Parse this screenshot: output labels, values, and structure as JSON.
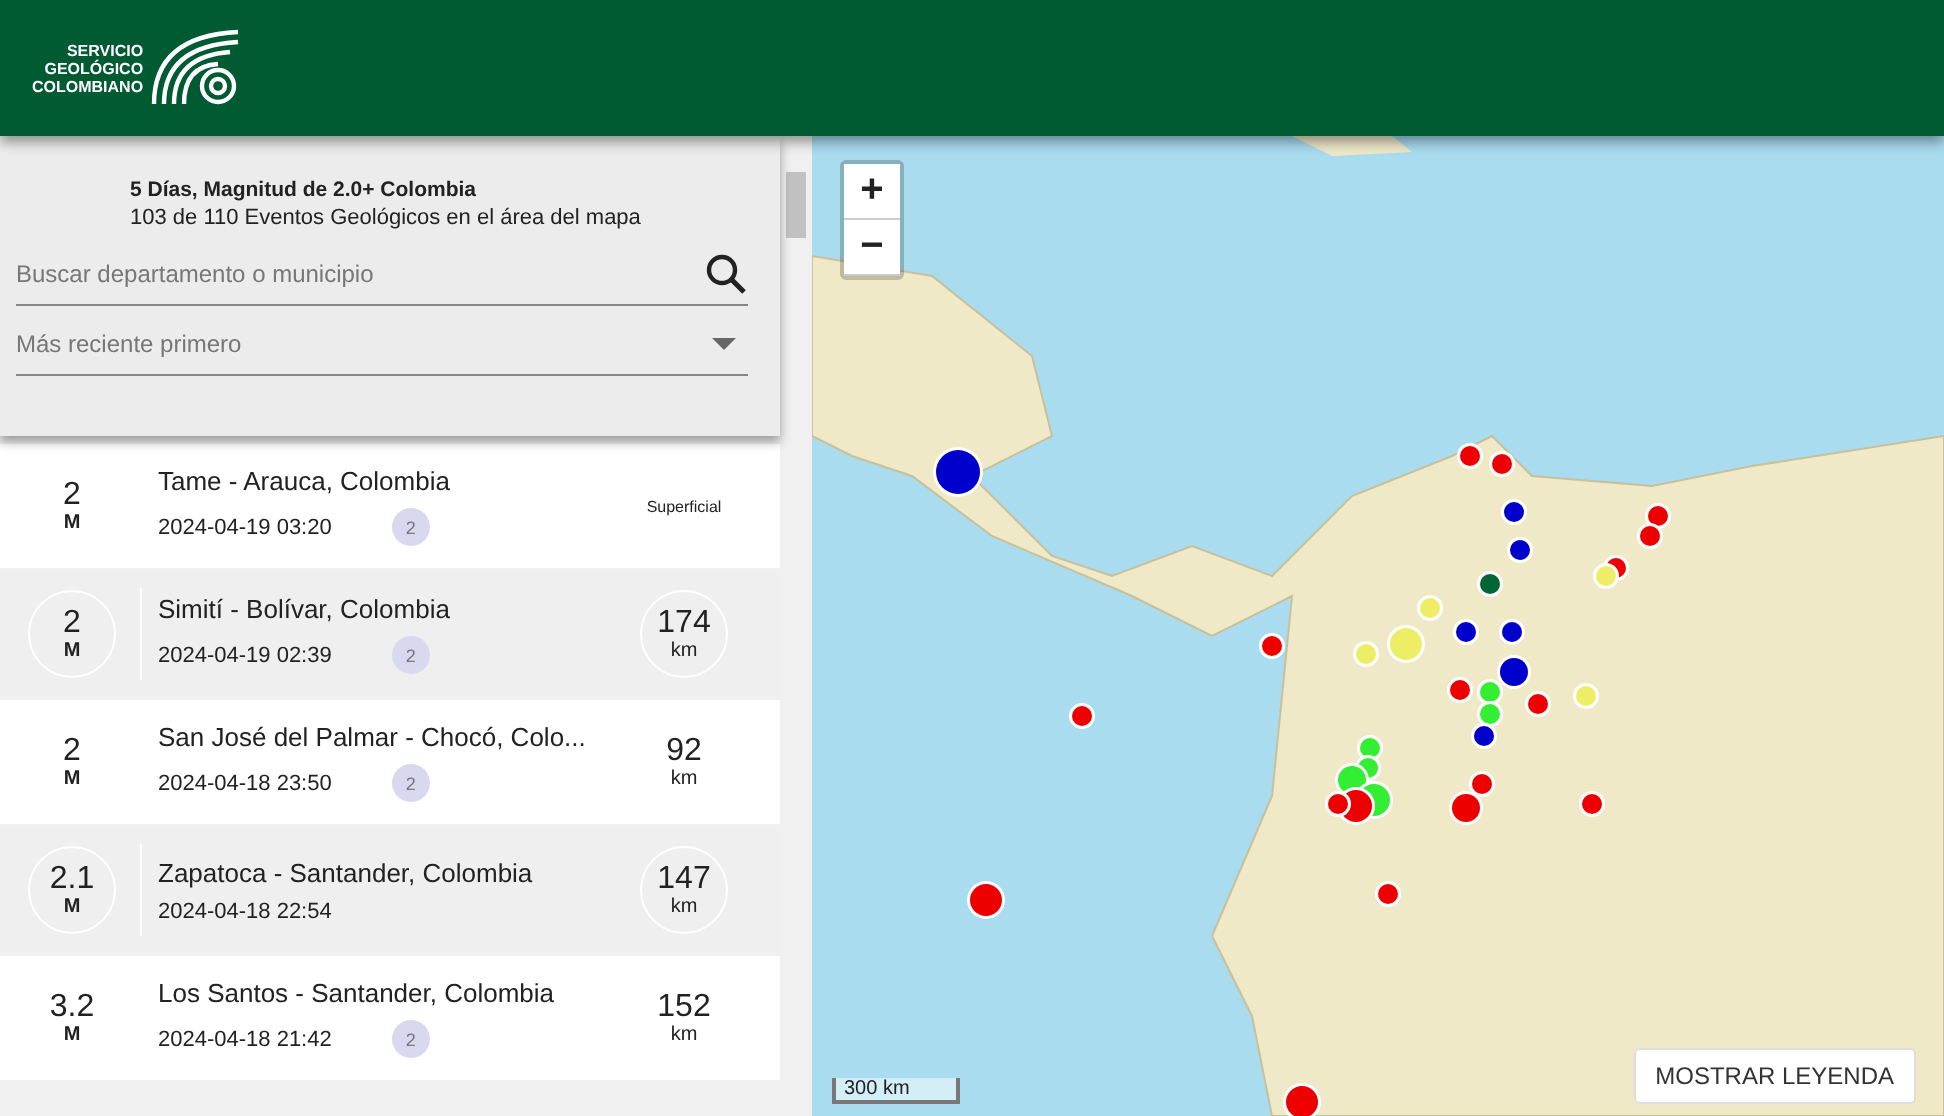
{
  "header": {
    "logo_lines": [
      "SERVICIO",
      "GEOLÓGICO",
      "COLOMBIANO"
    ]
  },
  "summary": {
    "title": "5 Días, Magnitud de 2.0+ Colombia",
    "subtitle": "103 de 110 Eventos Geológicos en el área del mapa"
  },
  "search": {
    "placeholder": "Buscar departamento o municipio"
  },
  "sort": {
    "value": "Más reciente primero"
  },
  "events": [
    {
      "magnitude": "2",
      "unit": "M",
      "place": "Tame - Arauca, Colombia",
      "datetime": "2024-04-19 03:20",
      "badge": "2",
      "kind": "label",
      "depth": "Superficial",
      "shaded": false
    },
    {
      "magnitude": "2",
      "unit": "M",
      "place": "Simití - Bolívar, Colombia",
      "datetime": "2024-04-19 02:39",
      "badge": "2",
      "kind": "value",
      "depth": "174",
      "depth_unit": "km",
      "shaded": true
    },
    {
      "magnitude": "2",
      "unit": "M",
      "place": "San José del Palmar - Chocó, Colo...",
      "datetime": "2024-04-18 23:50",
      "badge": "2",
      "kind": "value",
      "depth": "92",
      "depth_unit": "km",
      "shaded": false
    },
    {
      "magnitude": "2.1",
      "unit": "M",
      "place": "Zapatoca - Santander, Colombia",
      "datetime": "2024-04-18 22:54",
      "kind": "value",
      "depth": "147",
      "depth_unit": "km",
      "shaded": true
    },
    {
      "magnitude": "3.2",
      "unit": "M",
      "place": "Los Santos - Santander, Colombia",
      "datetime": "2024-04-18 21:42",
      "badge": "2",
      "kind": "value",
      "depth": "152",
      "depth_unit": "km",
      "shaded": false
    }
  ],
  "map": {
    "zoom_in": "+",
    "zoom_out": "−",
    "scale": "300 km",
    "legend_button": "MOSTRAR LEYENDA",
    "markers": [
      {
        "color": "#0000cc"
      },
      {
        "color": "#ee0000"
      },
      {
        "color": "#ee0000"
      },
      {
        "color": "#0000cc"
      },
      {
        "color": "#0000cc"
      },
      {
        "color": "#006633"
      },
      {
        "color": "#eeee66"
      },
      {
        "color": "#ee0000"
      },
      {
        "color": "#ee0000"
      },
      {
        "color": "#ee0000"
      },
      {
        "color": "#eeee66"
      },
      {
        "color": "#ee0000"
      },
      {
        "color": "#ee0000"
      },
      {
        "color": "#ee0000"
      },
      {
        "color": "#eeee66"
      },
      {
        "color": "#eeee66"
      },
      {
        "color": "#0000cc"
      },
      {
        "color": "#0000cc"
      },
      {
        "color": "#0000cc"
      },
      {
        "color": "#ee0000"
      },
      {
        "color": "#eeee66"
      },
      {
        "color": "#ee0000"
      },
      {
        "color": "#33ee33"
      },
      {
        "color": "#33ee33"
      },
      {
        "color": "#0000cc"
      },
      {
        "color": "#33ee33"
      },
      {
        "color": "#33ee33"
      },
      {
        "color": "#33ee33"
      },
      {
        "color": "#33ee33"
      },
      {
        "color": "#ee0000"
      },
      {
        "color": "#ee0000"
      },
      {
        "color": "#ee0000"
      },
      {
        "color": "#ee0000"
      },
      {
        "color": "#ee0000"
      },
      {
        "color": "#ee0000"
      },
      {
        "color": "#ee0000"
      }
    ]
  }
}
